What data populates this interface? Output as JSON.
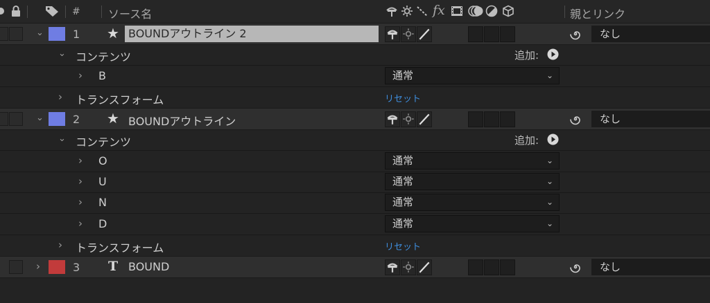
{
  "header": {
    "number": "#",
    "source_name": "ソース名",
    "fx": "fx",
    "parent_link": "親とリンク"
  },
  "layers": [
    {
      "number": "1",
      "name": "BOUNDアウトライン 2",
      "label_color": "#6f7de3",
      "type_icon": "star-icon",
      "selected": true,
      "parent": "なし",
      "contents_label": "コンテンツ",
      "add_label": "追加:",
      "groups": [
        {
          "name": "B",
          "blend": "通常"
        }
      ],
      "transform_label": "トランスフォーム",
      "reset_label": "リセット"
    },
    {
      "number": "2",
      "name": "BOUNDアウトライン",
      "label_color": "#6f7de3",
      "type_icon": "star-icon",
      "selected": false,
      "parent": "なし",
      "contents_label": "コンテンツ",
      "add_label": "追加:",
      "groups": [
        {
          "name": "O",
          "blend": "通常"
        },
        {
          "name": "U",
          "blend": "通常"
        },
        {
          "name": "N",
          "blend": "通常"
        },
        {
          "name": "D",
          "blend": "通常"
        }
      ],
      "transform_label": "トランスフォーム",
      "reset_label": "リセット"
    },
    {
      "number": "3",
      "name": "BOUND",
      "label_color": "#c23b3b",
      "type_icon": "text-layer-icon",
      "type_glyph": "T",
      "parent": "なし"
    }
  ],
  "colors": {
    "panel_bg": "#232323",
    "layer_row_bg": "#2f2f2f",
    "selected_name_bg": "#b7b7b7",
    "reset_link": "#3f8fe0"
  }
}
